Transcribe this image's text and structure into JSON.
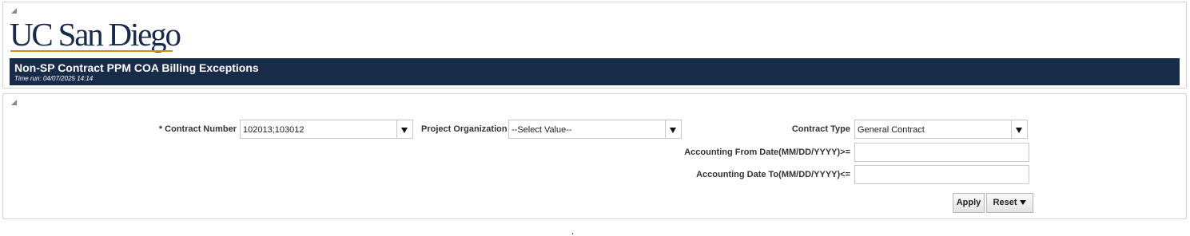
{
  "header": {
    "logo_text": "UC San Diego",
    "report_title": "Non-SP Contract PPM COA Billing Exceptions",
    "time_run": "Time run: 04/07/2025 14:14"
  },
  "prompts": {
    "contract_number": {
      "label": "* Contract Number",
      "value": "102013;103012"
    },
    "project_organization": {
      "label": "Project Organization",
      "value": "--Select Value--"
    },
    "contract_type": {
      "label": "Contract Type",
      "value": "General Contract"
    },
    "accounting_from_date": {
      "label": "Accounting From Date(MM/DD/YYYY)>=",
      "value": ""
    },
    "accounting_date_to": {
      "label": "Accounting Date To(MM/DD/YYYY)<=",
      "value": ""
    }
  },
  "buttons": {
    "apply_label": "Apply",
    "reset_label": "Reset"
  },
  "icons": {
    "collapse": "collapse-triangle-icon",
    "dropdown": "dropdown-arrow-icon"
  },
  "colors": {
    "title_bar_bg": "#182b49",
    "brand_navy": "#182b49",
    "brand_gold": "#c69214"
  }
}
